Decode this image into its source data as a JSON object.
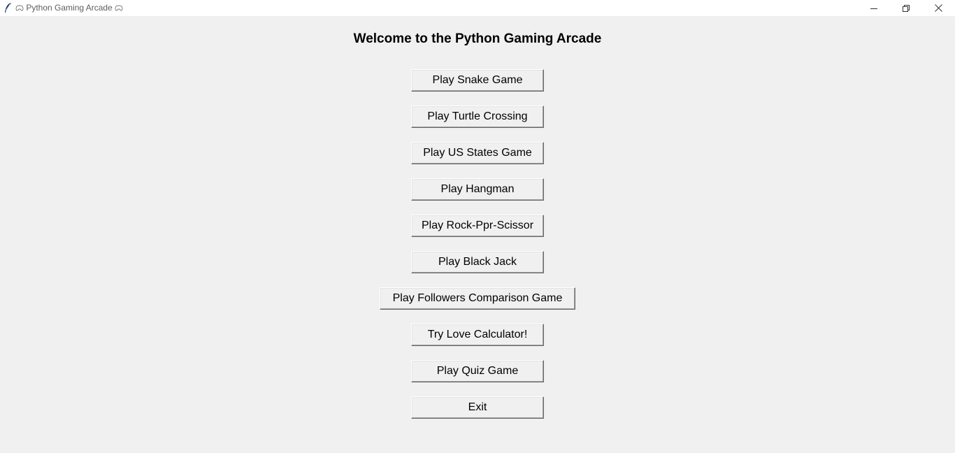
{
  "window": {
    "title": "Python Gaming Arcade",
    "icon": "tk-feather-icon",
    "title_decoration": "gamepad-icon",
    "controls": [
      "minimize-icon",
      "restore-icon",
      "close-icon"
    ]
  },
  "main": {
    "heading": "Welcome to the Python Gaming Arcade",
    "buttons": [
      {
        "label": "Play Snake Game"
      },
      {
        "label": "Play Turtle Crossing"
      },
      {
        "label": "Play US States Game"
      },
      {
        "label": "Play Hangman"
      },
      {
        "label": "Play Rock-Ppr-Scissor"
      },
      {
        "label": "Play Black Jack"
      },
      {
        "label": "Play Followers Comparison Game"
      },
      {
        "label": "Try Love Calculator!"
      },
      {
        "label": "Play Quiz Game"
      },
      {
        "label": "Exit"
      }
    ]
  },
  "colors": {
    "background": "#f0f0f0",
    "titlebar": "#ffffff",
    "text": "#000000"
  }
}
